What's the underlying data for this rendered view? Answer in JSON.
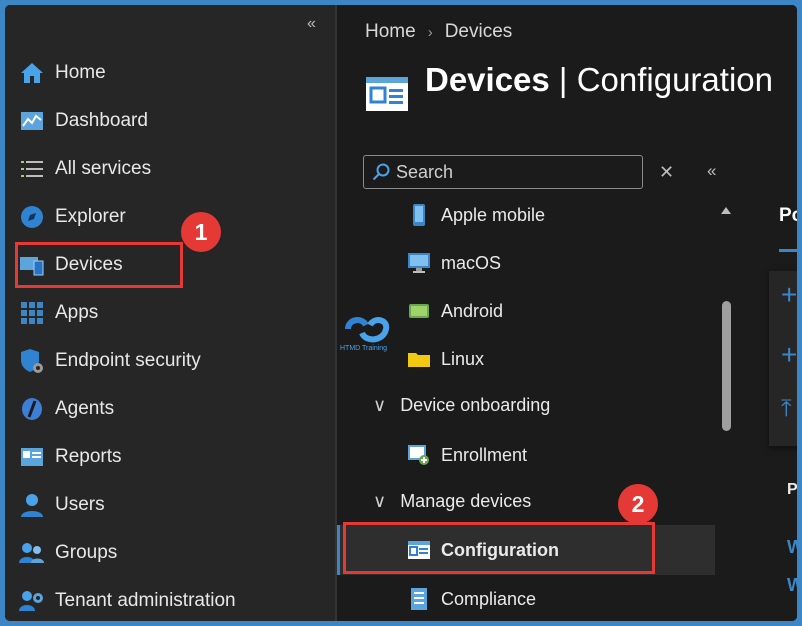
{
  "sidebar": {
    "collapse_glyph": "«",
    "items": [
      {
        "label": "Home",
        "icon": "home-icon"
      },
      {
        "label": "Dashboard",
        "icon": "dashboard-icon"
      },
      {
        "label": "All services",
        "icon": "list-icon"
      },
      {
        "label": "Explorer",
        "icon": "explorer-icon"
      },
      {
        "label": "Devices",
        "icon": "devices-icon"
      },
      {
        "label": "Apps",
        "icon": "apps-grid-icon"
      },
      {
        "label": "Endpoint security",
        "icon": "shield-gear-icon"
      },
      {
        "label": "Agents",
        "icon": "agents-icon"
      },
      {
        "label": "Reports",
        "icon": "reports-icon"
      },
      {
        "label": "Users",
        "icon": "user-icon"
      },
      {
        "label": "Groups",
        "icon": "groups-icon"
      },
      {
        "label": "Tenant administration",
        "icon": "tenant-admin-icon"
      }
    ]
  },
  "breadcrumb": {
    "home": "Home",
    "separator": "›",
    "current": "Devices"
  },
  "header": {
    "title_bold": "Devices",
    "title_sep": " | ",
    "title_rest": "Configuration"
  },
  "search": {
    "placeholder": "Search",
    "clear_glyph": "✕",
    "collapse_glyph": "«"
  },
  "menu": {
    "items": [
      {
        "label": "Apple mobile",
        "icon": "apple-mobile-icon"
      },
      {
        "label": "macOS",
        "icon": "macos-icon"
      },
      {
        "label": "Android",
        "icon": "android-icon"
      },
      {
        "label": "Linux",
        "icon": "linux-icon"
      }
    ],
    "group_onboarding": "Device onboarding",
    "enrollment": "Enrollment",
    "group_manage": "Manage devices",
    "configuration": "Configuration",
    "compliance": "Compliance",
    "chevron_glyph": "∨"
  },
  "right_pane": {
    "tab_fragment": "Po",
    "col_fragment": "P",
    "link_fragment_1": "W",
    "link_fragment_2": "W"
  },
  "annotations": {
    "badge_1": "1",
    "badge_2": "2",
    "watermark_text": "HTMD Training"
  },
  "colors": {
    "accent": "#3d86c6",
    "highlight": "#e53935",
    "sidebar_bg": "#262626",
    "main_bg": "#1b1b1b"
  }
}
